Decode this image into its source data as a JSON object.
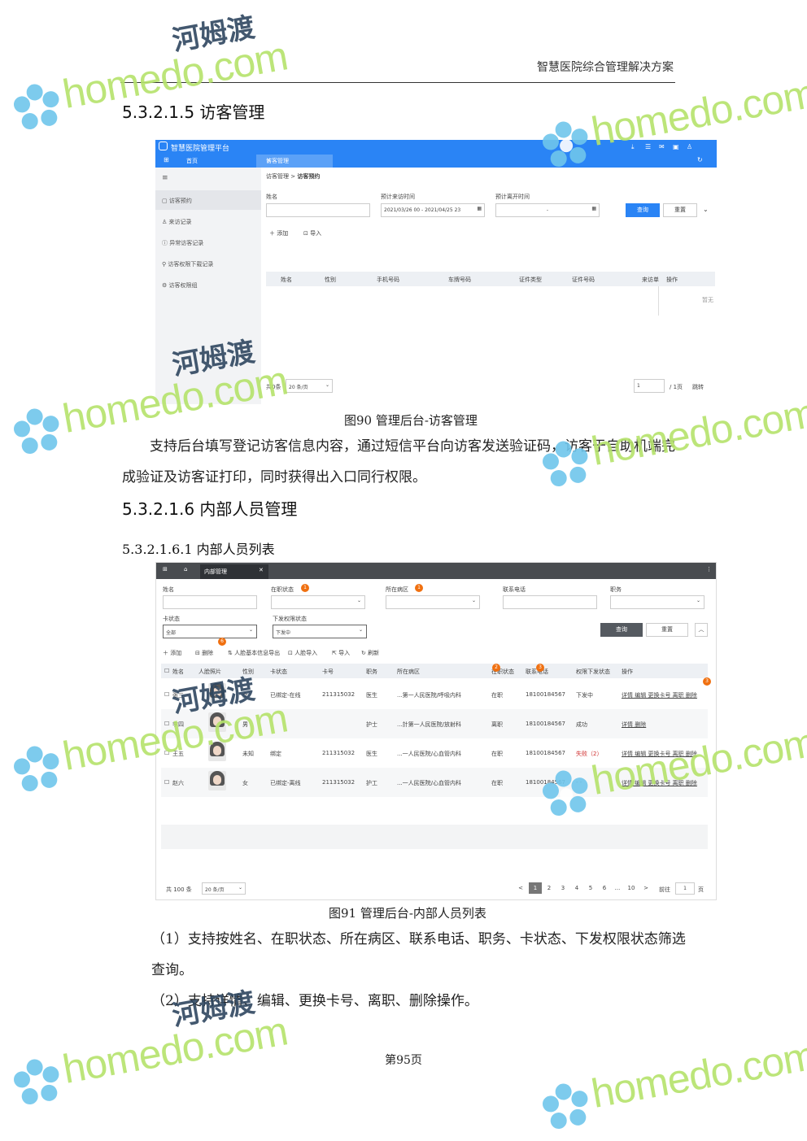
{
  "header": {
    "doc_title": "智慧医院综合管理解决方案"
  },
  "section1": {
    "heading": "5.3.2.1.5 访客管理"
  },
  "shot1": {
    "app_title": "智慧医院管理平台",
    "tab_home": "首页",
    "tab_current": "访客管理",
    "sidebar": [
      "访客预约",
      "来访记录",
      "异常访客记录",
      "访客权限下载记录",
      "访客权限组"
    ],
    "breadcrumb_parent": "访客管理",
    "breadcrumb_current": "访客预约",
    "label_name": "姓名",
    "label_arrive": "预计来访时间",
    "arrive_value": "2021/03/26 00 - 2021/04/25 23",
    "label_leave": "预计离开时间",
    "leave_value": "-",
    "btn_query": "查询",
    "btn_reset": "重置",
    "btn_add": "添加",
    "btn_import": "导入",
    "columns": [
      "姓名",
      "性别",
      "手机号码",
      "车牌号码",
      "证件类型",
      "证件号码",
      "来访单",
      "操作"
    ],
    "empty_text": "暂无",
    "total": "共0条",
    "page_size": "20 条/页",
    "page_input": "1",
    "page_total": "/ 1页",
    "jump": "跳转"
  },
  "caption1": "图90 管理后台-访客管理",
  "para1": "支持后台填写登记访客信息内容，通过短信平台向访客发送验证码，访客于自助机端完成验证及访客证打印，同时获得出入口同行权限。",
  "section2": {
    "heading": "5.3.2.1.6 内部人员管理"
  },
  "subsection2": {
    "heading": "5.3.2.1.6.1 内部人员列表"
  },
  "shot2": {
    "tab_current": "内部管理",
    "filters": {
      "name": "姓名",
      "status": "在职状态",
      "ward": "所在病区",
      "phone": "联系电话",
      "post": "职务",
      "card_status": "卡状态",
      "card_value": "全部",
      "perm_status": "下发权限状态",
      "perm_value": "下发中"
    },
    "btn_query": "查询",
    "btn_reset": "重置",
    "toolbar": [
      "添加",
      "删除",
      "人脸基本信息导出",
      "人脸导入",
      "导入",
      "刷新"
    ],
    "badges": [
      "1",
      "1",
      "6",
      "2",
      "3",
      "3"
    ],
    "columns": [
      "姓名",
      "人脸照片",
      "性别",
      "卡状态",
      "卡号",
      "职务",
      "所在病区",
      "在职状态",
      "联系电话",
      "权限下发状态",
      "操作"
    ],
    "rows": [
      {
        "name": "张三",
        "gender": "女",
        "card": "已绑定-在线",
        "cardno": "211315032",
        "post": "医生",
        "ward": "...第一人民医院/呼吸内科",
        "state": "在职",
        "phone": "18100184567",
        "perm": "下发中",
        "ops": "详情 编辑 更换卡号 离职 删除"
      },
      {
        "name": "李四",
        "gender": "男",
        "card": "",
        "cardno": "",
        "post": "护士",
        "ward": "...計第一人民医院/放射科",
        "state": "离职",
        "phone": "18100184567",
        "perm": "成功",
        "ops": "详情 删除"
      },
      {
        "name": "王五",
        "gender": "未知",
        "card": "绑定",
        "cardno": "211315032",
        "post": "医生",
        "ward": "...一人民医院/心血管内科",
        "state": "在职",
        "phone": "18100184567",
        "perm": "失败（2）",
        "ops": "详情 编辑 更换卡号 离职 删除"
      },
      {
        "name": "赵六",
        "gender": "女",
        "card": "已绑定-离线",
        "cardno": "211315032",
        "post": "护工",
        "ward": "...一人民医院/心血管内科",
        "state": "在职",
        "phone": "18100184567",
        "perm": "- -",
        "ops": "详情 编辑 更换卡号 离职 删除"
      }
    ],
    "total": "共 100 条",
    "page_size": "20 条/页",
    "pages": [
      "<",
      "1",
      "2",
      "3",
      "4",
      "5",
      "6",
      "...",
      "10",
      ">"
    ],
    "goto_label": "前往",
    "goto_value": "1",
    "goto_unit": "页"
  },
  "caption2": "图91 管理后台-内部人员列表",
  "item1": "（1）支持按姓名、在职状态、所在病区、联系电话、职务、卡状态、下发权限状态筛选查询。",
  "item2": "（2）支持详情、编辑、更换卡号、离职、删除操作。",
  "footer": {
    "page": "第95页"
  },
  "watermark": {
    "brand": "homedo.com",
    "cn": "河姆渡"
  },
  "colors": {
    "accent": "#2a84f5",
    "dark_bar": "#494c50",
    "brand_green": "#b5e36b",
    "badge": "#f07010",
    "link": "#1a66d6"
  }
}
